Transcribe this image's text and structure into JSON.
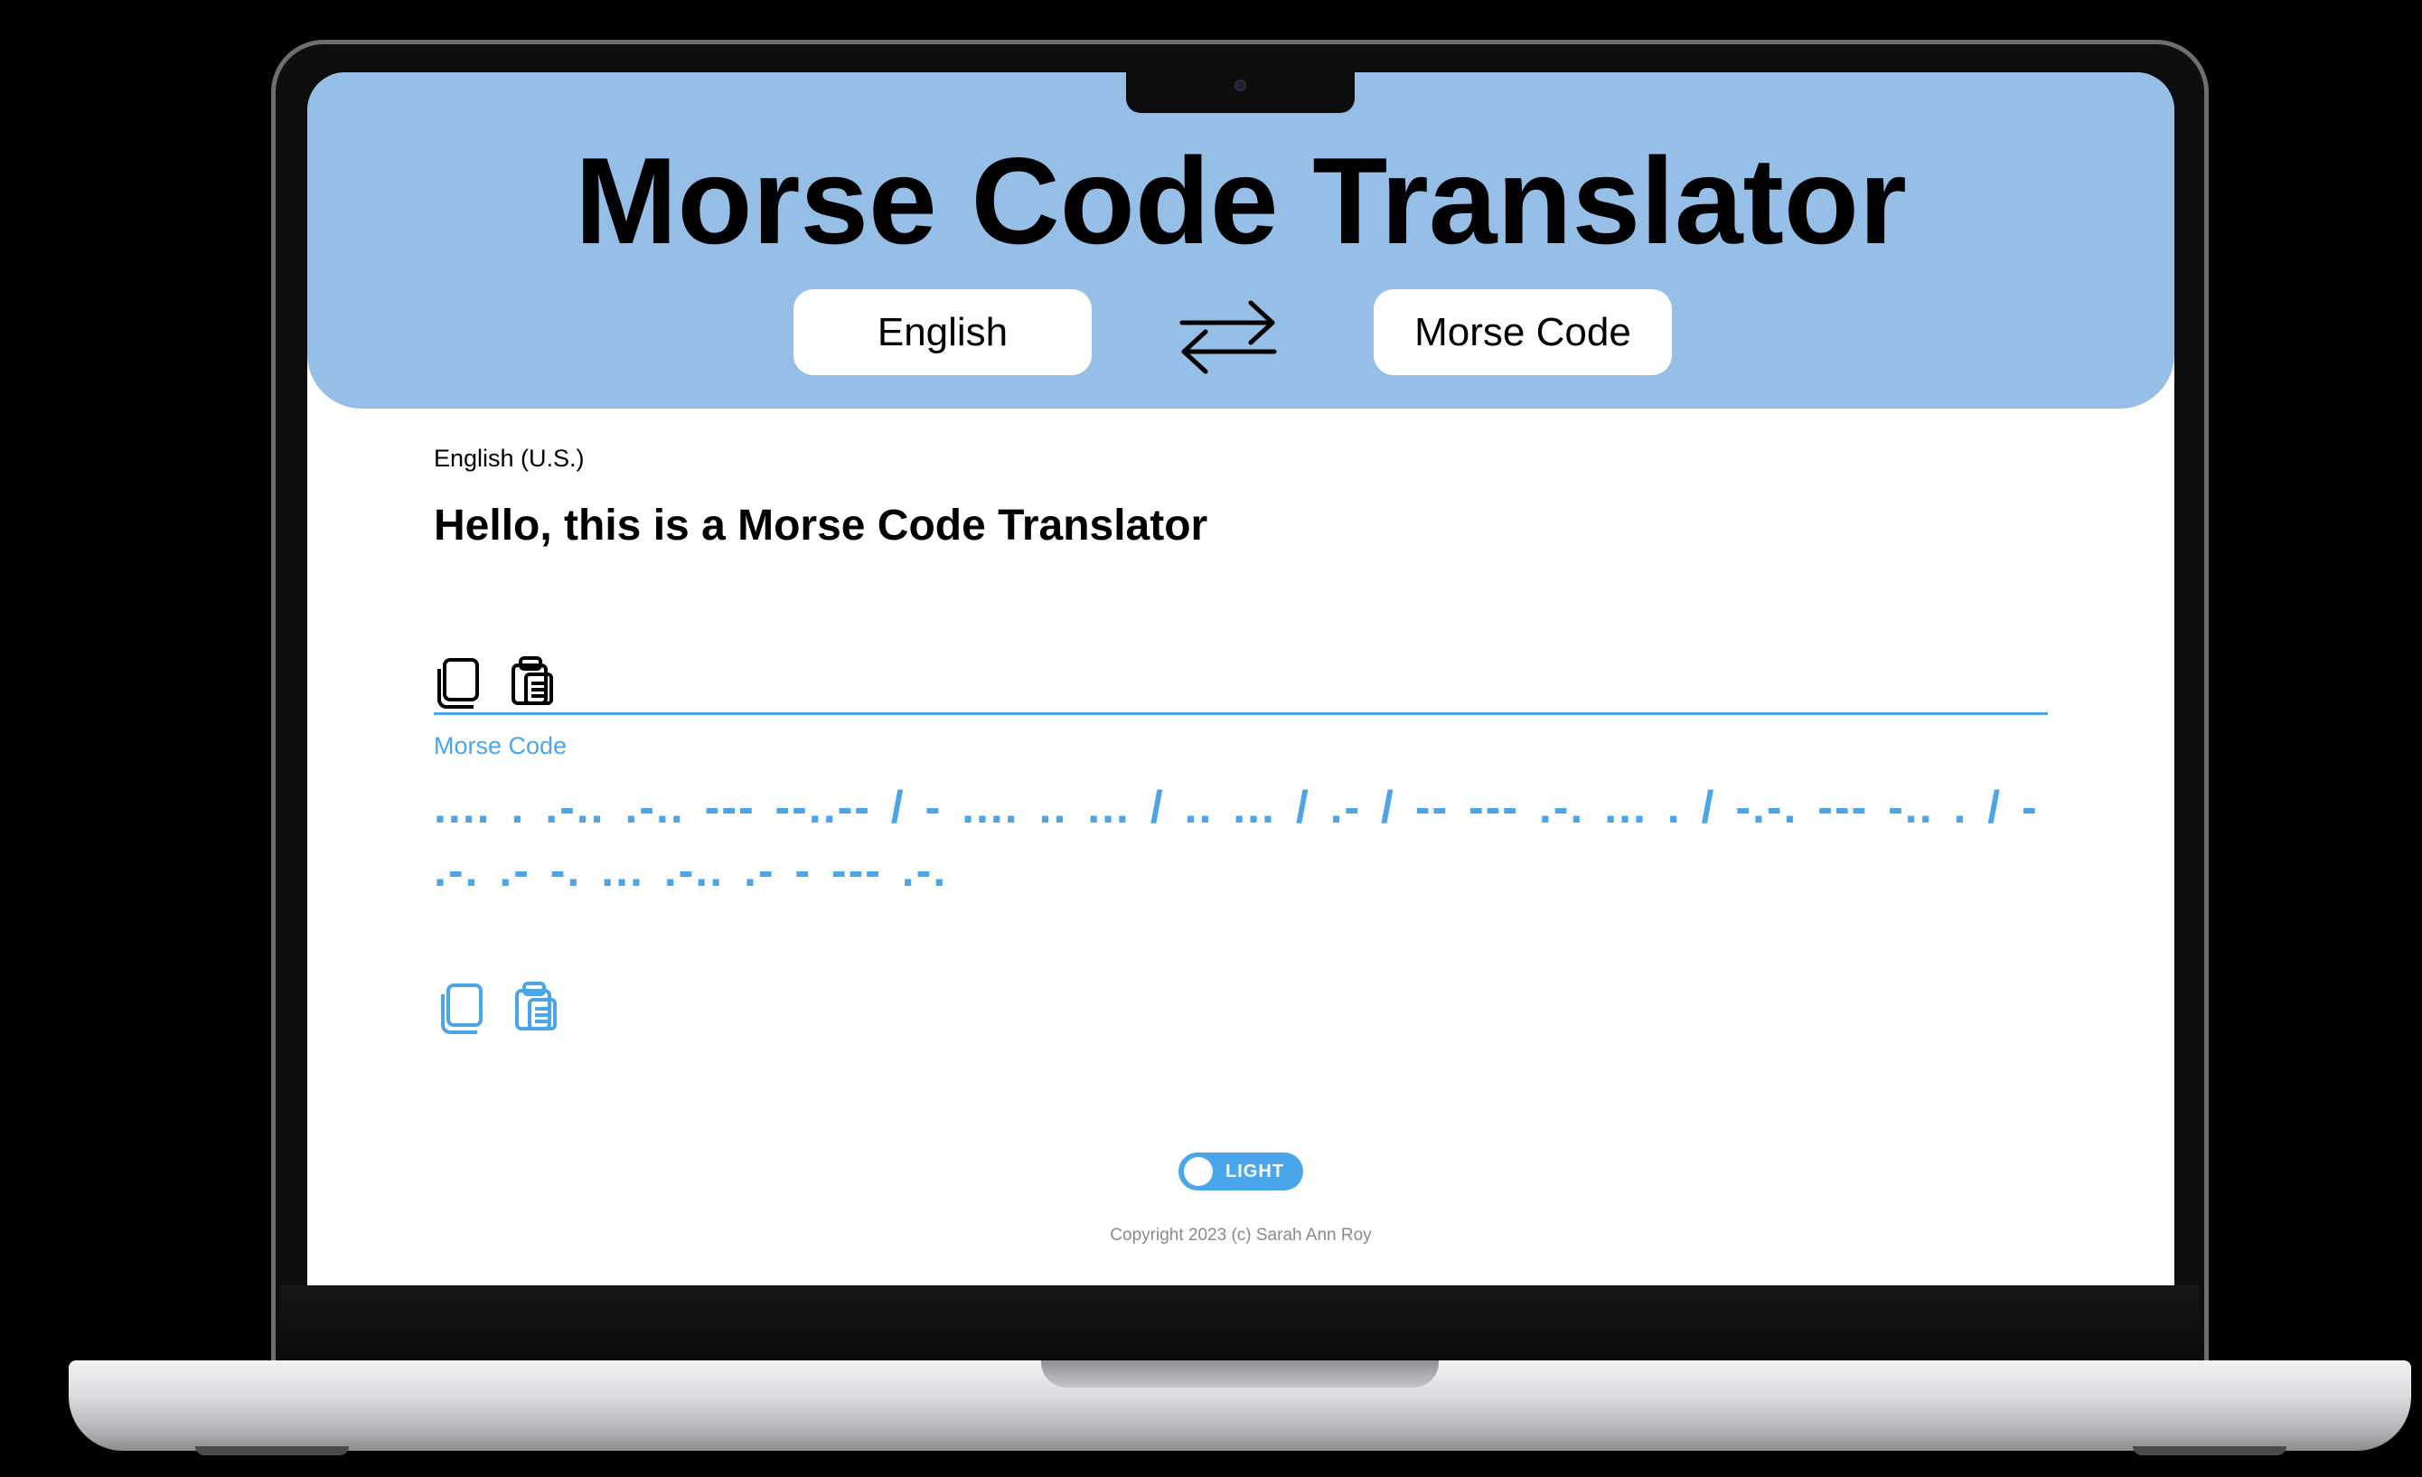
{
  "app": {
    "title": "Morse Code Translator"
  },
  "header": {
    "source_button": "English",
    "target_button": "Morse Code"
  },
  "source": {
    "language_label": "English (U.S.)",
    "text": "Hello, this is a Morse Code Translator"
  },
  "target": {
    "language_label": "Morse Code",
    "text": ".... . .-.. .-.. --- --..--  / - .... .. ...  / .. ...  / .-  / -- --- .-. ... .  / -.-. --- -.. .  / - .-. .- -. ... .-.. .- - --- .-."
  },
  "theme_toggle": {
    "label": "LIGHT"
  },
  "footer": {
    "copyright": "Copyright 2023 (c) Sarah Ann Roy"
  },
  "colors": {
    "header_bg": "#95bfe7",
    "accent": "#4aa6e8",
    "text": "#000000",
    "muted": "#8a8a8a"
  },
  "icons": {
    "swap": "swap-arrows-icon",
    "copy": "copy-icon",
    "paste": "clipboard-icon"
  }
}
